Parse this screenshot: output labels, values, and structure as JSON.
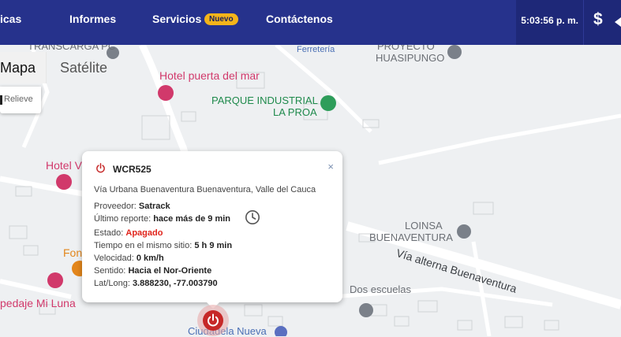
{
  "nav": {
    "item_fragment": "icas",
    "reports": "Informes",
    "services": "Servicios",
    "services_badge": "Nuevo",
    "contact": "Contáctenos",
    "time": "5:03:56 p. m.",
    "currency_symbol": "$"
  },
  "map_controls": {
    "map": "Mapa",
    "satellite": "Satélite",
    "relief": "Relieve"
  },
  "map_labels": {
    "transcarga": "TRANSCARGA PC",
    "ferreteria": "Ferretería",
    "proyecto": "PROYECTO",
    "huasipungo": "HUASIPUNGO",
    "hotel_puerta": "Hotel puerta del mar",
    "parque1": "PARQUE INDUSTRIAL",
    "parque2": "LA PROA",
    "hotel_v": "Hotel V",
    "loinsa": "LOINSA",
    "buenaventura": "BUENAVENTURA",
    "via_alterna": "Vía alterna Buenaventura",
    "fone": "Fone",
    "hospedaje": "pedaje Mi Luna",
    "dos_escuelas": "Dos escuelas",
    "ciudadela": "Ciudadela Nueva"
  },
  "popup": {
    "plate": "WCR525",
    "address": "Vía Urbana Buenaventura Buenaventura, Valle del Cauca",
    "provider_label": "Proveedor:",
    "provider": "Satrack",
    "last_report_label": "Último reporte:",
    "last_report": "hace más de 9 min",
    "state_label": "Estado:",
    "state": "Apagado",
    "same_site_label": "Tiempo en el mismo sitio:",
    "same_site": "5 h 9 min",
    "speed_label": "Velocidad:",
    "speed": "0 km/h",
    "direction_label": "Sentido:",
    "direction": "Hacia el Nor-Oriente",
    "latlong_label": "Lat/Long:",
    "latlong": "3.888230, -77.003790",
    "close": "×"
  },
  "colors": {
    "nav_bg": "#26328c",
    "badge": "#f4b41a",
    "status_off": "#e0241b",
    "marker": "#c62828"
  }
}
